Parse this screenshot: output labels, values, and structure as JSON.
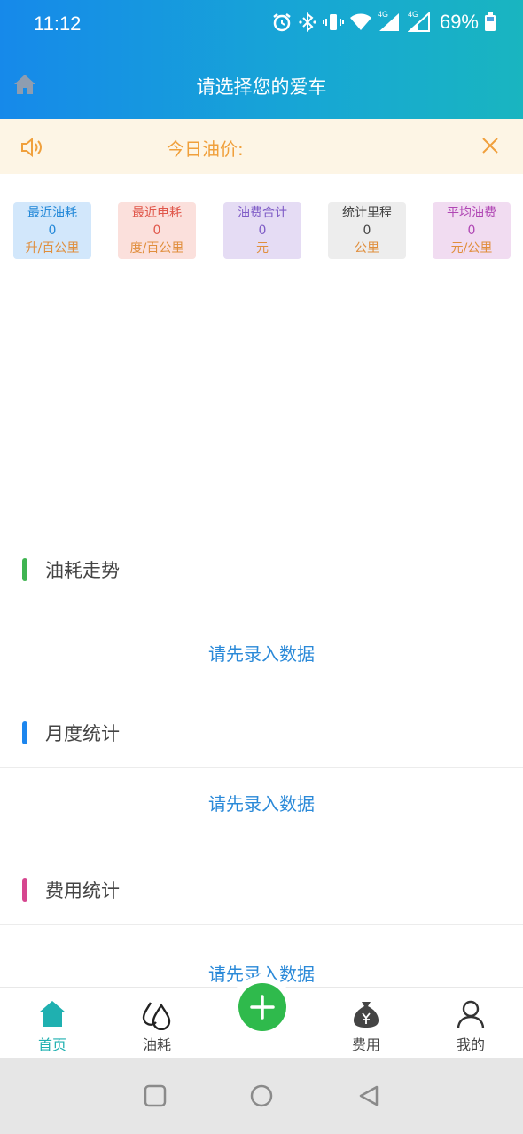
{
  "status_bar": {
    "time": "11:12",
    "battery": "69%",
    "network_1": "4G",
    "network_2": "4G",
    "icons": [
      "alarm-icon",
      "bluetooth-icon",
      "vibrate-icon",
      "wifi-icon",
      "signal-icon",
      "signal-icon",
      "battery-icon"
    ]
  },
  "header": {
    "title": "请选择您的爱车",
    "home_icon": "home-icon",
    "background_colors": [
      "#1689ea",
      "#19b5c0"
    ]
  },
  "notice": {
    "text": "今日油价:",
    "speaker_icon": "speaker-icon",
    "close_icon": "close-icon",
    "color": "#f0a03c"
  },
  "stats": [
    {
      "label": "最近油耗",
      "value": "0",
      "unit": "升/百公里",
      "bg": "#d2e7fb",
      "label_color": "#2388d8",
      "value_color": "#2388d8",
      "unit_color": "#e08e3c"
    },
    {
      "label": "最近电耗",
      "value": "0",
      "unit": "度/百公里",
      "bg": "#fbe0dc",
      "label_color": "#e0564a",
      "value_color": "#e0564a",
      "unit_color": "#e08e3c"
    },
    {
      "label": "油费合计",
      "value": "0",
      "unit": "元",
      "bg": "#e5dcf4",
      "label_color": "#7e5bc6",
      "value_color": "#7e5bc6",
      "unit_color": "#e08e3c"
    },
    {
      "label": "统计里程",
      "value": "0",
      "unit": "公里",
      "bg": "#ededed",
      "label_color": "#444444",
      "value_color": "#444444",
      "unit_color": "#e08e3c"
    },
    {
      "label": "平均油费",
      "value": "0",
      "unit": "元/公里",
      "bg": "#f1dcf1",
      "label_color": "#b046b4",
      "value_color": "#b046b4",
      "unit_color": "#e08e3c"
    }
  ],
  "sections": [
    {
      "title": "油耗走势",
      "bar_color": "#3fb451",
      "empty": "请先录入数据"
    },
    {
      "title": "月度统计",
      "bar_color": "#1d86ee",
      "empty": "请先录入数据"
    },
    {
      "title": "费用统计",
      "bar_color": "#d6468f",
      "empty": "请先录入数据"
    }
  ],
  "tabbar": {
    "items": [
      {
        "label": "首页",
        "icon": "home-icon",
        "active": true
      },
      {
        "label": "油耗",
        "icon": "drops-icon",
        "active": false
      },
      {
        "label": "费用",
        "icon": "money-bag-icon",
        "active": false
      },
      {
        "label": "我的",
        "icon": "user-icon",
        "active": false
      }
    ],
    "add_icon": "plus-icon",
    "active_color": "#1fb0b0",
    "fab_color": "#2fba4c"
  },
  "system_nav": {
    "icons": [
      "recents-icon",
      "home-circle-icon",
      "back-icon"
    ]
  }
}
